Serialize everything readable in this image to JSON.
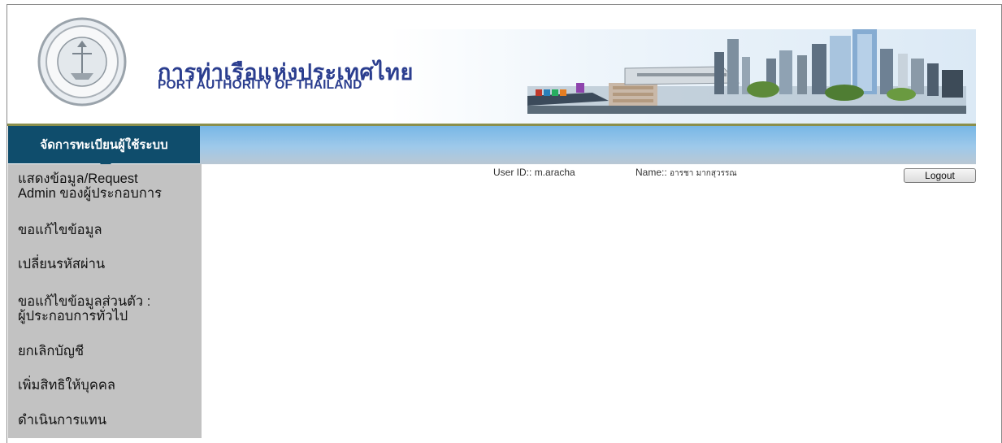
{
  "header": {
    "org_name_thai": "การท่าเรือแห่งประเทศไทย",
    "org_name_english": "PORT AUTHORITY OF THAILAND",
    "colors": {
      "title": "#2b3e8f",
      "menu_head": "#0f4d6c",
      "sidebar": "#c2c2c2"
    }
  },
  "menu": {
    "title": "จัดการทะเบียนผู้ใช้ระบบ",
    "items": [
      {
        "line1": "แสดงข้อมูล/Request",
        "line2": "Admin ของผู้ประกอบการ"
      },
      {
        "line1": "ขอแก้ไขข้อมูล",
        "line2": ""
      },
      {
        "line1": "เปลี่ยนรหัสผ่าน",
        "line2": ""
      },
      {
        "line1": "ขอแก้ไขข้อมูลส่วนตัว :",
        "line2": "ผู้ประกอบการทั่วไป"
      },
      {
        "line1": "ยกเลิกบัญชี",
        "line2": ""
      },
      {
        "line1": "เพิ่มสิทธิให้บุคคล",
        "line2": ""
      },
      {
        "line1": "ดำเนินการแทน",
        "line2": ""
      }
    ]
  },
  "user": {
    "user_id_label": "User ID::",
    "user_id": "m.aracha",
    "name_label": "Name::",
    "name": "อารชา มากสุวรรณ",
    "logout_label": "Logout"
  }
}
